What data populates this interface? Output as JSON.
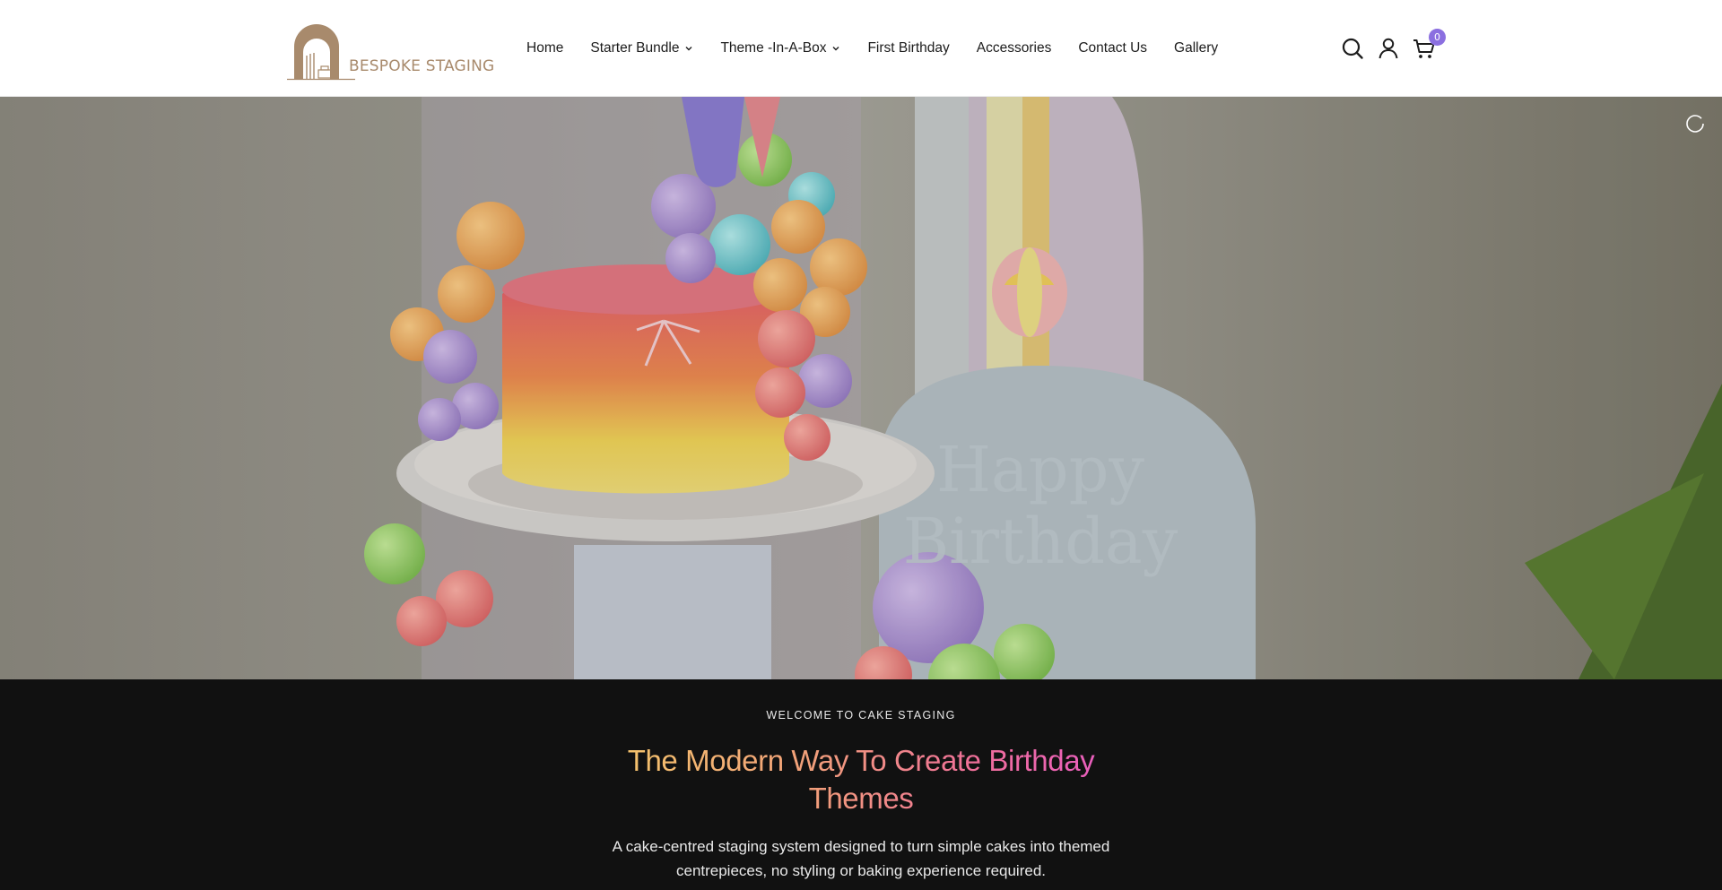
{
  "brand": {
    "name": "BESPOKE STAGING",
    "color": "#a88a6c"
  },
  "nav": {
    "items": [
      {
        "label": "Home",
        "dropdown": false
      },
      {
        "label": "Starter Bundle",
        "dropdown": true
      },
      {
        "label": "Theme -In-A-Box",
        "dropdown": true
      },
      {
        "label": "First Birthday",
        "dropdown": false
      },
      {
        "label": "Accessories",
        "dropdown": false
      },
      {
        "label": "Contact Us",
        "dropdown": false
      },
      {
        "label": "Gallery",
        "dropdown": false
      }
    ]
  },
  "header_icons": {
    "search": "search-icon",
    "account": "user-icon",
    "cart": "cart-icon",
    "cart_count": "0",
    "badge_color": "#8b6fe0"
  },
  "hero": {
    "image": "rainbow-cake-with-balloons",
    "control": "pause-icon"
  },
  "intro": {
    "eyebrow": "WELCOME TO CAKE STAGING",
    "headline": "The Modern Way To Create Birthday Themes",
    "subtext": "A cake-centred staging system designed to turn simple cakes into themed centrepieces, no styling or baking experience required.",
    "background": "#111111",
    "gradient": [
      "#f5c96a",
      "#ef6e9a",
      "#e85ac8"
    ]
  }
}
